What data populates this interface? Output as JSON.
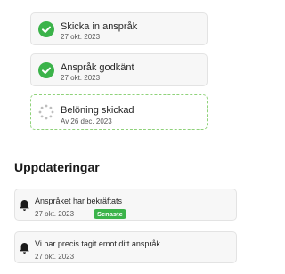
{
  "progress_steps": [
    {
      "title": "Skicka in anspråk",
      "date": "27 okt. 2023",
      "status": "done",
      "icon": "check-circle-icon"
    },
    {
      "title": "Anspråk godkänt",
      "date": "27 okt. 2023",
      "status": "done",
      "icon": "check-circle-icon"
    },
    {
      "title": "Belöning skickad",
      "date": "Av 26 dec. 2023",
      "status": "pending",
      "icon": "spinner-icon"
    }
  ],
  "updates": {
    "heading": "Uppdateringar",
    "items": [
      {
        "title": "Anspråket har bekräftats",
        "date": "27 okt. 2023",
        "badge": "Senaste",
        "icon": "bell-icon"
      },
      {
        "title": "Vi har precis tagit emot ditt anspråk",
        "date": "27 okt. 2023",
        "icon": "bell-icon"
      }
    ]
  },
  "colors": {
    "success": "#3bb34a",
    "pending_border": "#8fd27a",
    "card_bg": "#f7f7f7",
    "card_border": "#e3e3e3"
  }
}
